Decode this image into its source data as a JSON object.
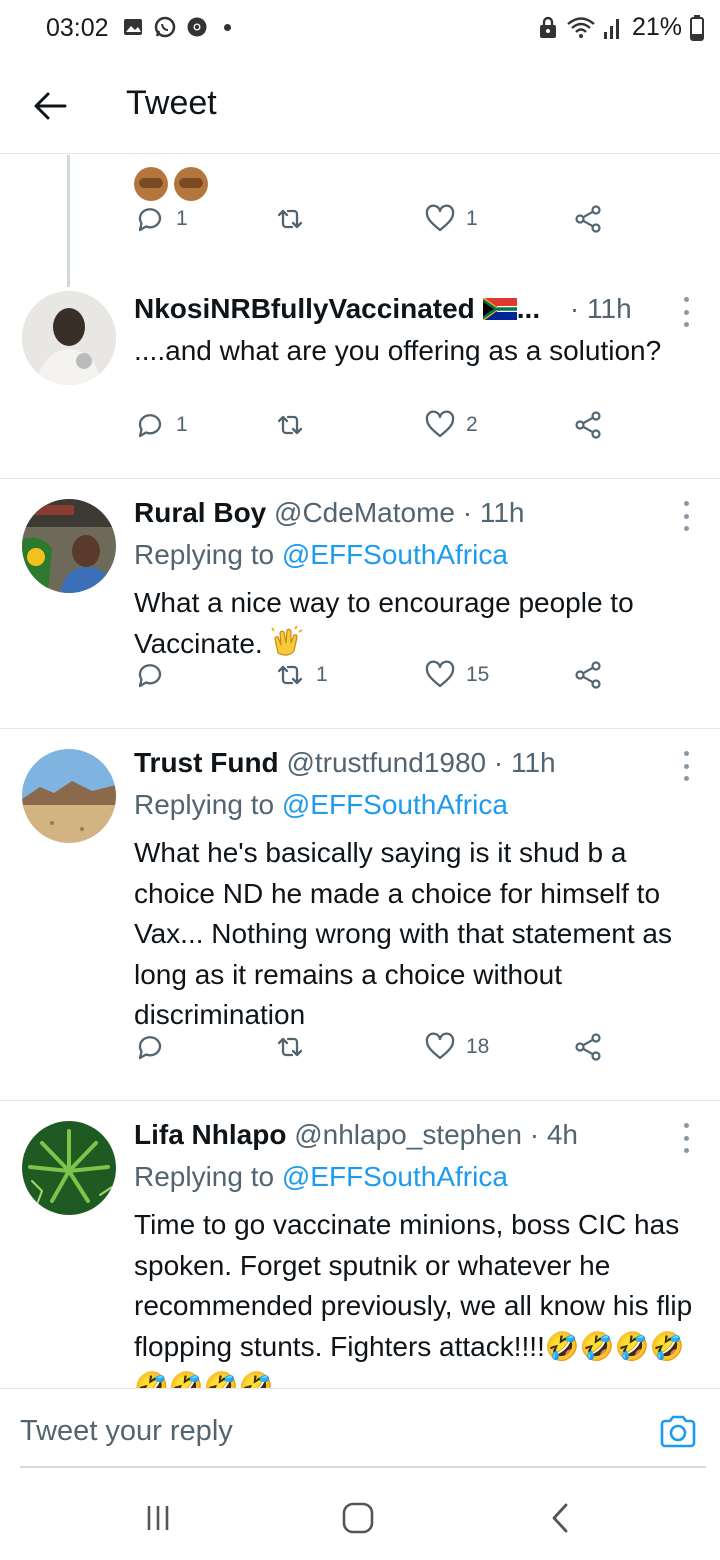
{
  "status_bar": {
    "time": "03:02",
    "battery": "21%"
  },
  "header": {
    "title": "Tweet"
  },
  "top_partial": {
    "reply_count": "1",
    "retweet_count": "",
    "like_count": "1"
  },
  "tweets": [
    {
      "name": "NkosiNRBfullyVaccinated",
      "name_suffix": "...",
      "handle": "",
      "time": "· 11h",
      "replying_label": "",
      "replying_to": "",
      "text": "....and what are you offering as a solution?",
      "reply_count": "1",
      "retweet_count": "",
      "like_count": "2"
    },
    {
      "name": "Rural Boy",
      "handle": "@CdeMatome",
      "time": "· 11h",
      "replying_label": "Replying to ",
      "replying_to": "@EFFSouthAfrica",
      "text": "What a nice way to encourage people to Vaccinate.",
      "reply_count": "",
      "retweet_count": "1",
      "like_count": "15"
    },
    {
      "name": "Trust Fund",
      "handle": "@trustfund1980",
      "time": "· 11h",
      "replying_label": "Replying to ",
      "replying_to": "@EFFSouthAfrica",
      "text": "What he's basically saying is it shud b a choice ND he made a choice for himself to Vax... Nothing wrong with that statement as long as it remains a choice without discrimination",
      "reply_count": "",
      "retweet_count": "",
      "like_count": "18"
    },
    {
      "name": "Lifa Nhlapo",
      "handle": "@nhlapo_stephen",
      "time": "· 4h",
      "replying_label": "Replying to ",
      "replying_to": "@EFFSouthAfrica",
      "text": "Time to go vaccinate minions, boss CIC has spoken. Forget sputnik or whatever he recommended previously, we all know his flip flopping stunts. Fighters attack!!!!",
      "text_emoji": "🤣🤣🤣🤣🤣🤣🤣🤣"
    }
  ],
  "reply_bar": {
    "placeholder": "Tweet your reply"
  },
  "colors": {
    "link": "#1d9bf0",
    "secondary_text": "#536471",
    "divider": "#e6e9eb"
  }
}
